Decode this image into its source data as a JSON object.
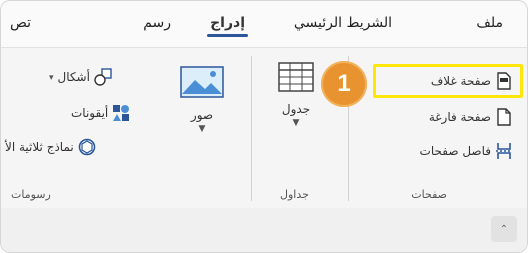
{
  "menu": {
    "file": "ملف",
    "home": "الشريط الرئيسي",
    "insert": "إدراج",
    "draw": "رسم",
    "more": "تص"
  },
  "pages_group": {
    "label": "صفحات",
    "cover_page": "صفحة غلاف",
    "blank_page": "صفحة فارغة",
    "page_break": "فاصل صفحات"
  },
  "tables_group": {
    "label": "جداول",
    "table": "جدول"
  },
  "illustrations_group": {
    "label": "رسومات",
    "pictures": "صور",
    "shapes": "أشكال",
    "icons": "أيقونات",
    "models_3d": "نماذج ثلاثية الأ"
  },
  "callout": {
    "number": "1"
  },
  "colors": {
    "accent": "#2b579a",
    "highlight": "#ffe60a",
    "callout": "#e8932f"
  }
}
